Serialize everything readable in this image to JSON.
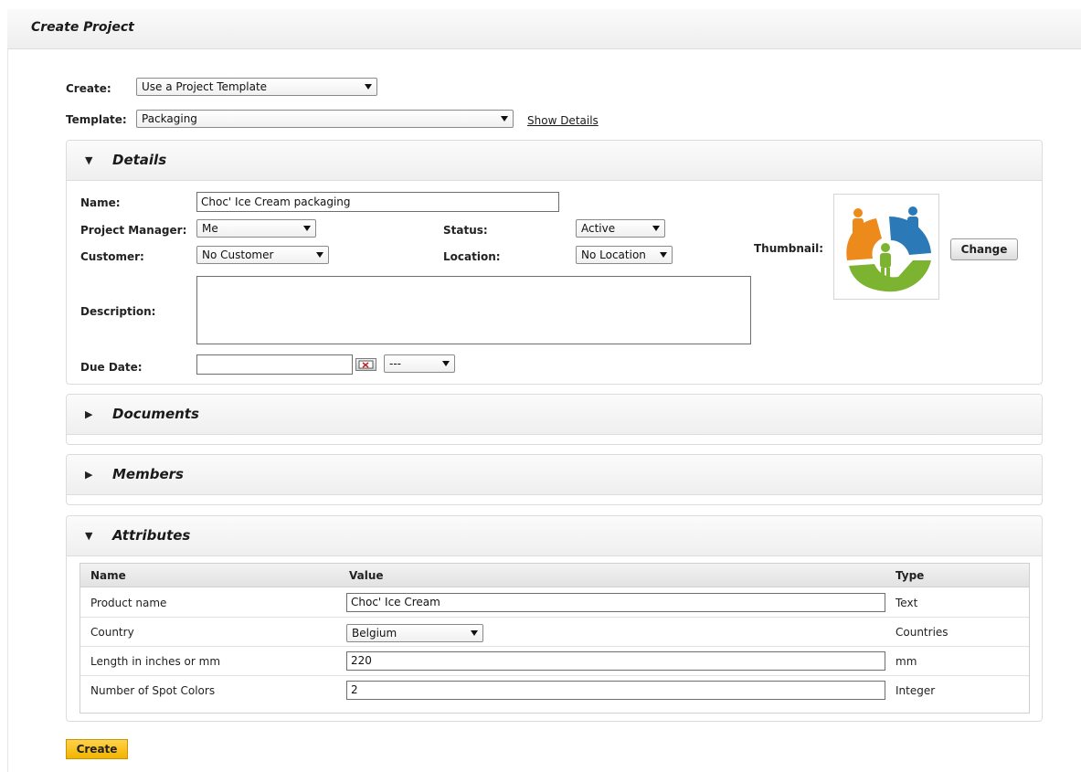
{
  "page": {
    "title": "Create Project"
  },
  "create_row": {
    "label": "Create:",
    "selected": "Use a Project Template"
  },
  "template_row": {
    "label": "Template:",
    "selected": "Packaging",
    "show_details": "Show Details"
  },
  "details": {
    "title": "Details",
    "name_label": "Name:",
    "name_value": "Choc' Ice Cream packaging",
    "pm_label": "Project Manager:",
    "pm_value": "Me",
    "status_label": "Status:",
    "status_value": "Active",
    "customer_label": "Customer:",
    "customer_value": "No Customer",
    "location_label": "Location:",
    "location_value": "No Location",
    "description_label": "Description:",
    "description_value": "",
    "due_label": "Due Date:",
    "due_value": "",
    "due_time": "---",
    "thumbnail_label": "Thumbnail:",
    "change_label": "Change"
  },
  "documents": {
    "title": "Documents"
  },
  "members": {
    "title": "Members"
  },
  "attributes": {
    "title": "Attributes",
    "columns": {
      "name": "Name",
      "value": "Value",
      "type": "Type"
    },
    "rows": [
      {
        "name": "Product name",
        "value": "Choc' Ice Cream",
        "type": "Text"
      },
      {
        "name": "Country",
        "value": "Belgium",
        "type": "Countries"
      },
      {
        "name": "Length in inches or mm",
        "value": "220",
        "type": "mm"
      },
      {
        "name": "Number of Spot Colors",
        "value": "2",
        "type": "Integer"
      }
    ]
  },
  "footer": {
    "create_label": "Create"
  },
  "colors": {
    "accent": "#f2b400",
    "orange_piece": "#ec8a1c",
    "blue_piece": "#2c79b8",
    "green_piece": "#7cb431"
  }
}
